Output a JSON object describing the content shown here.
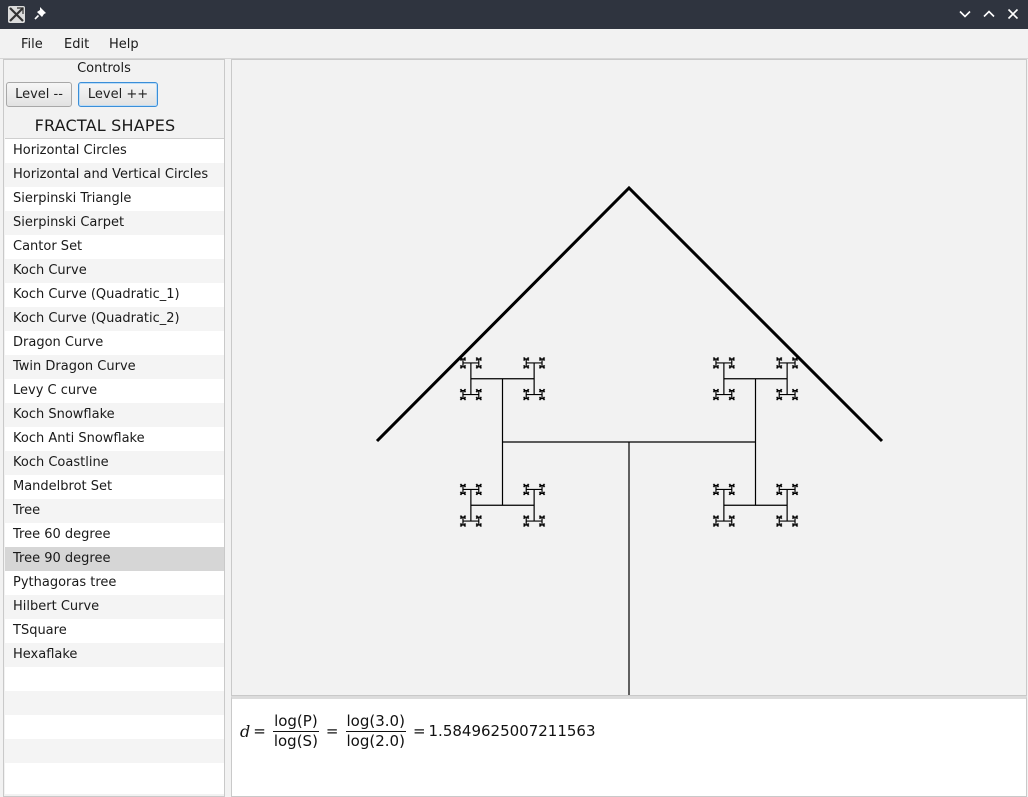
{
  "menu": {
    "file": "File",
    "edit": "Edit",
    "help": "Help"
  },
  "controls": {
    "label": "Controls",
    "level_down": "Level --",
    "level_up": "Level ++"
  },
  "list_title": "FRACTAL SHAPES",
  "fractals": [
    "Horizontal Circles",
    "Horizontal and Vertical Circles",
    "Sierpinski Triangle",
    "Sierpinski Carpet",
    "Cantor Set",
    "Koch Curve",
    "Koch Curve (Quadratic_1)",
    "Koch Curve (Quadratic_2)",
    "Dragon Curve",
    "Twin Dragon Curve",
    "Levy C curve",
    "Koch Snowflake",
    "Koch Anti Snowflake",
    "Koch Coastline",
    "Mandelbrot Set",
    "Tree",
    "Tree 60 degree",
    "Tree 90 degree",
    "Pythagoras tree",
    "Hilbert Curve",
    "TSquare",
    "Hexaflake"
  ],
  "selected_index": 17,
  "formula": {
    "variable": "d",
    "eq": "=",
    "num1": "log(P)",
    "den1": "log(S)",
    "num2": "log(3.0)",
    "den2": "log(2.0)",
    "result": "1.5849625007211563"
  },
  "colors": {
    "titlebar": "#2f343f",
    "selected_row": "#d6d6d6",
    "focus": "#3a8ed8"
  }
}
